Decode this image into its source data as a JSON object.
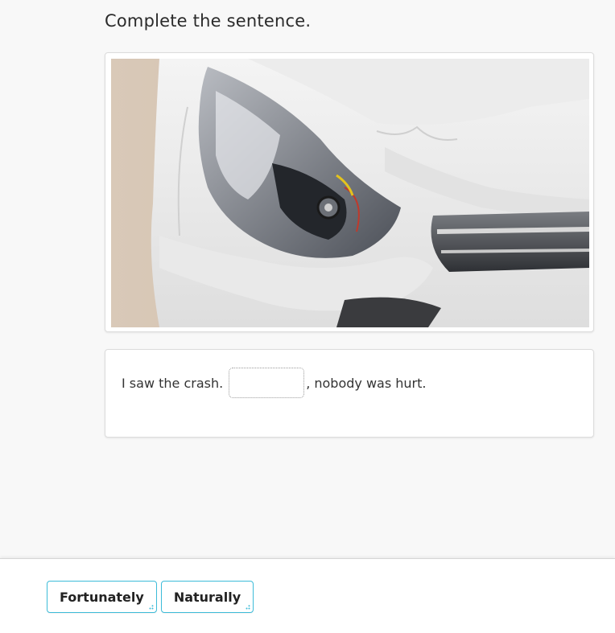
{
  "instruction": "Complete the sentence.",
  "image": {
    "description_icon": "damaged-car-headlight-photo"
  },
  "sentence": {
    "before": "I saw the crash.",
    "blank_value": "",
    "after": ", nobody was hurt."
  },
  "answer_options": [
    {
      "label": "Fortunately",
      "icon": "drag-handle-icon"
    },
    {
      "label": "Naturally",
      "icon": "drag-handle-icon"
    }
  ],
  "colors": {
    "accent": "#3dbcd9",
    "background": "#f8f8f8",
    "card": "#ffffff"
  }
}
